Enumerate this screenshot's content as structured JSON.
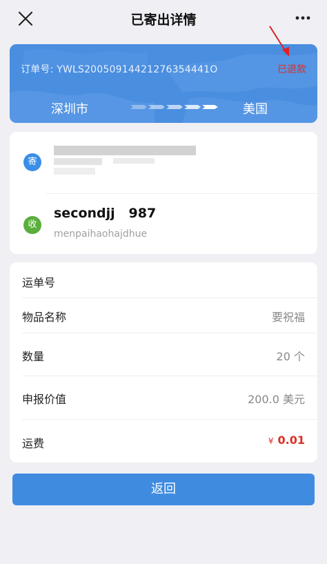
{
  "header": {
    "title": "已寄出详情",
    "close_icon": "close-icon",
    "more_icon": "more-horizontal-icon"
  },
  "banner": {
    "order_label": "订单号:",
    "order_number": "YWLS20050914421276354441O",
    "status": "已退款",
    "from_city": "深圳市",
    "to_city": "美国",
    "bg_color": "#4a8ee0",
    "status_color": "#d93025"
  },
  "sender": {
    "badge": "寄"
  },
  "receiver": {
    "badge": "收",
    "name": "secondjj   987",
    "address": "menpaihaohajdhue"
  },
  "details": {
    "waybill_label": "运单号",
    "waybill_value": "",
    "item_name_label": "物品名称",
    "item_name_value": "要祝福",
    "quantity_label": "数量",
    "quantity_value": "20 个",
    "declared_value_label": "申报价值",
    "declared_value_value": "200.0 美元",
    "fee_label": "运费",
    "fee_currency": "¥",
    "fee_value": "0.01"
  },
  "actions": {
    "back_label": "返回"
  }
}
